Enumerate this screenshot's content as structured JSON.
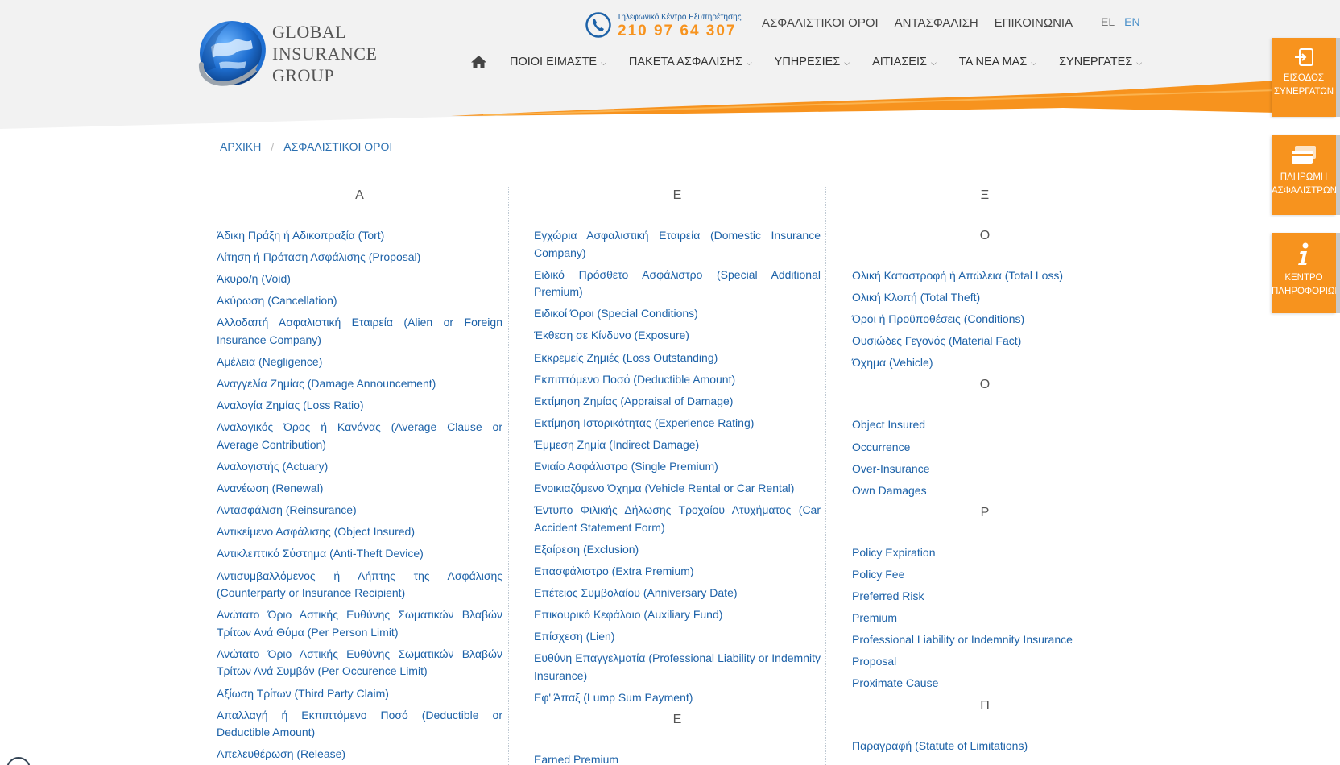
{
  "logo": {
    "line1": "GLOBAL",
    "line2": "INSURANCE",
    "line3": "GROUP"
  },
  "phone": {
    "caption": "Τηλεφωνικό Κέντρο Εξυπηρέτησης",
    "number": "210 97 64 307"
  },
  "top_links": [
    "ΑΣΦΑΛΙΣΤΙΚΟΙ ΟΡΟΙ",
    "ΑΝΤΑΣΦΑΛΙΣΗ",
    "ΕΠΙΚΟΙΝΩΝΙΑ"
  ],
  "lang": {
    "el": "EL",
    "en": "EN"
  },
  "nav": [
    "ΠΟΙΟΙ ΕΙΜΑΣΤΕ",
    "ΠΑΚΕΤΑ ΑΣΦΑΛΙΣΗΣ",
    "ΥΠΗΡΕΣΙΕΣ",
    "ΑΙΤΙΑΣΕΙΣ",
    "ΤΑ ΝΕΑ ΜΑΣ",
    "ΣΥΝΕΡΓΑΤΕΣ"
  ],
  "side_tabs": {
    "partners": "ΕΙΣΟΔΟΣ\nΣΥΝΕΡΓΑΤΩΝ",
    "payment": "ΠΛΗΡΩΜΗ\nΑΣΦΑΛΙΣΤΡΩΝ",
    "info": "ΚΕΝΤΡΟ\nΠΛΗΡΟΦΟΡΙΩΝ"
  },
  "breadcrumb": {
    "home": "ΑΡΧΙΚΗ",
    "sep": "/",
    "current": "ΑΣΦΑΛΙΣΤΙΚΟΙ ΟΡΟΙ"
  },
  "columns": [
    {
      "sections": [
        {
          "letter": "Α",
          "terms": [
            "Άδικη Πράξη ή Αδικοπραξία (Tort)",
            "Αίτηση ή Πρόταση Ασφάλισης (Proposal)",
            "Άκυρο/η (Void)",
            "Ακύρωση (Cancellation)",
            "Αλλοδαπή Ασφαλιστική Εταιρεία (Alien or Foreign Insurance Company)",
            "Αμέλεια (Negligence)",
            "Αναγγελία Ζημίας (Damage Announcement)",
            "Αναλογία Ζημίας (Loss Ratio)",
            "Αναλογικός Όρος ή Κανόνας (Average Clause or Average Contribution)",
            "Αναλογιστής (Actuary)",
            "Ανανέωση (Renewal)",
            "Αντασφάλιση (Reinsurance)",
            "Αντικείμενο Ασφάλισης (Object Insured)",
            "Αντικλεπτικό Σύστημα (Anti-Theft Device)",
            "Αντισυμβαλλόμενος ή Λήπτης της Ασφάλισης (Counterparty or Insurance Recipient)",
            "Ανώτατο Όριο Αστικής Ευθύνης Σωματικών Βλαβών Τρίτων Ανά Θύμα (Per Person Limit)",
            "Ανώτατο Όριο Αστικής Ευθύνης Σωματικών Βλαβών Τρίτων Ανά Συμβάν (Per Occurence Limit)",
            "Αξίωση Τρίτων (Third Party Claim)",
            "Απαλλαγή ή Εκπιπτόμενο Ποσό (Deductible or Deductible Amount)",
            "Απελευθέρωση (Release)"
          ]
        }
      ]
    },
    {
      "sections": [
        {
          "letter": "Ε",
          "terms": [
            "Εγχώρια Ασφαλιστική Εταιρεία (Domestic Insurance Company)",
            "Ειδικό Πρόσθετο Ασφάλιστρο (Special Additional Premium)",
            "Ειδικοί Όροι (Special Conditions)",
            "Έκθεση σε Κίνδυνο (Exposure)",
            "Εκκρεμείς Ζημιές (Loss Outstanding)",
            "Εκπιπτόμενο Ποσό (Deductible Amount)",
            "Εκτίμηση Ζημίας (Appraisal of Damage)",
            "Εκτίμηση Ιστορικότητας (Experience Rating)",
            "Έμμεση Ζημία (Indirect Damage)",
            "Ενιαίο Ασφάλιστρο (Single Premium)",
            "Ενοικιαζόμενο Όχημα (Vehicle Rental or Car Rental)",
            "Έντυπο Φιλικής Δήλωσης Τροχαίου Ατυχήματος (Car Accident Statement Form)",
            "Εξαίρεση (Exclusion)",
            "Επασφάλιστρο (Extra Premium)",
            "Επέτειος Συμβολαίου (Anniversary Date)",
            "Επικουρικό Κεφάλαιο (Auxiliary Fund)",
            "Επίσχεση (Lien)",
            "Ευθύνη Επαγγελματία (Professional Liability or Indemnity Insurance)",
            "Εφ' Άπαξ (Lump Sum Payment)"
          ]
        },
        {
          "letter": "E",
          "terms": [
            "Earned Premium"
          ]
        }
      ]
    },
    {
      "sections": [
        {
          "letter": "Ξ",
          "terms": []
        },
        {
          "letter": "Ο",
          "terms": [
            "Ολική Καταστροφή ή Απώλεια (Total Loss)",
            "Ολική Κλοπή (Total Theft)",
            "Όροι ή Προϋποθέσεις (Conditions)",
            "Ουσιώδες Γεγονός (Material Fact)",
            "Όχημα (Vehicle)"
          ]
        },
        {
          "letter": "O",
          "terms": [
            "Object Insured",
            "Occurrence",
            "Over-Insurance",
            "Own Damages"
          ]
        },
        {
          "letter": "P",
          "terms": [
            "Policy Expiration",
            "Policy Fee",
            "Preferred Risk",
            "Premium",
            "Professional Liability or Indemnity Insurance",
            "Proposal",
            "Proximate Cause"
          ]
        },
        {
          "letter": "Π",
          "terms": [
            "Παραγραφή (Statute of Limitations)"
          ]
        }
      ]
    }
  ],
  "colors": {
    "accent": "#f7931e",
    "link": "#1d62a8",
    "header_bg": "#f2f2f2"
  }
}
